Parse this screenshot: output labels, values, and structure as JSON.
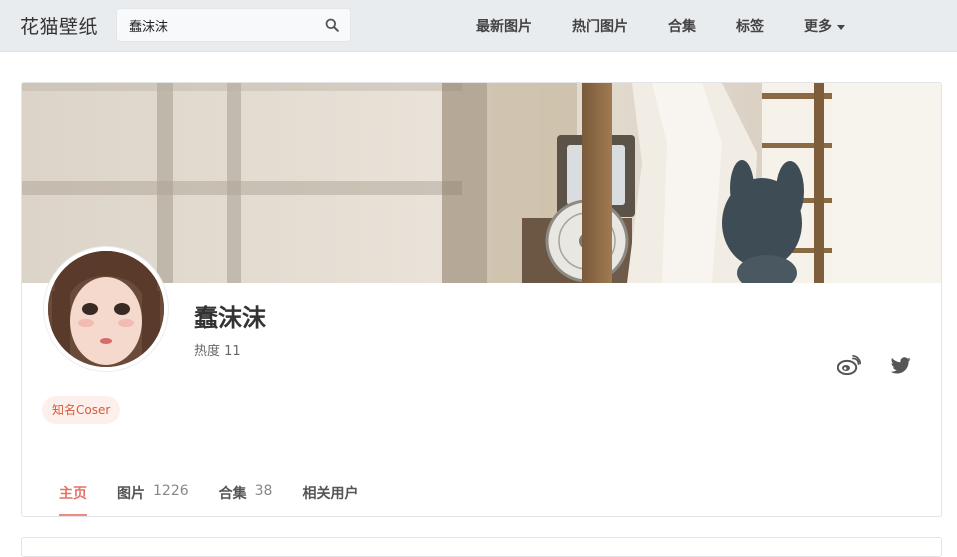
{
  "header": {
    "brand": "花猫壁纸",
    "search": {
      "value": "蠢沫沫",
      "icon": "search-icon"
    },
    "nav": [
      {
        "label": "最新图片"
      },
      {
        "label": "热门图片"
      },
      {
        "label": "合集"
      },
      {
        "label": "标签"
      },
      {
        "label": "更多",
        "icon": "caret-down-icon"
      }
    ]
  },
  "profile": {
    "name": "蠢沫沫",
    "heat": "热度 11",
    "badge": "知名Coser",
    "social": [
      {
        "icon": "weibo-icon"
      },
      {
        "icon": "twitter-icon"
      }
    ],
    "tabs": [
      {
        "label": "主页",
        "count": "",
        "active": true
      },
      {
        "label": "图片",
        "count": "1226",
        "active": false
      },
      {
        "label": "合集",
        "count": "38",
        "active": false
      },
      {
        "label": "相关用户",
        "count": "",
        "active": false
      }
    ]
  },
  "colors": {
    "accent": "#e57368",
    "accent_underline": "#ef8a80",
    "badge_bg": "#fdf0ec",
    "badge_text": "#d65a3a",
    "topbar_bg": "#e9ecef",
    "icon_gray": "#555555"
  }
}
